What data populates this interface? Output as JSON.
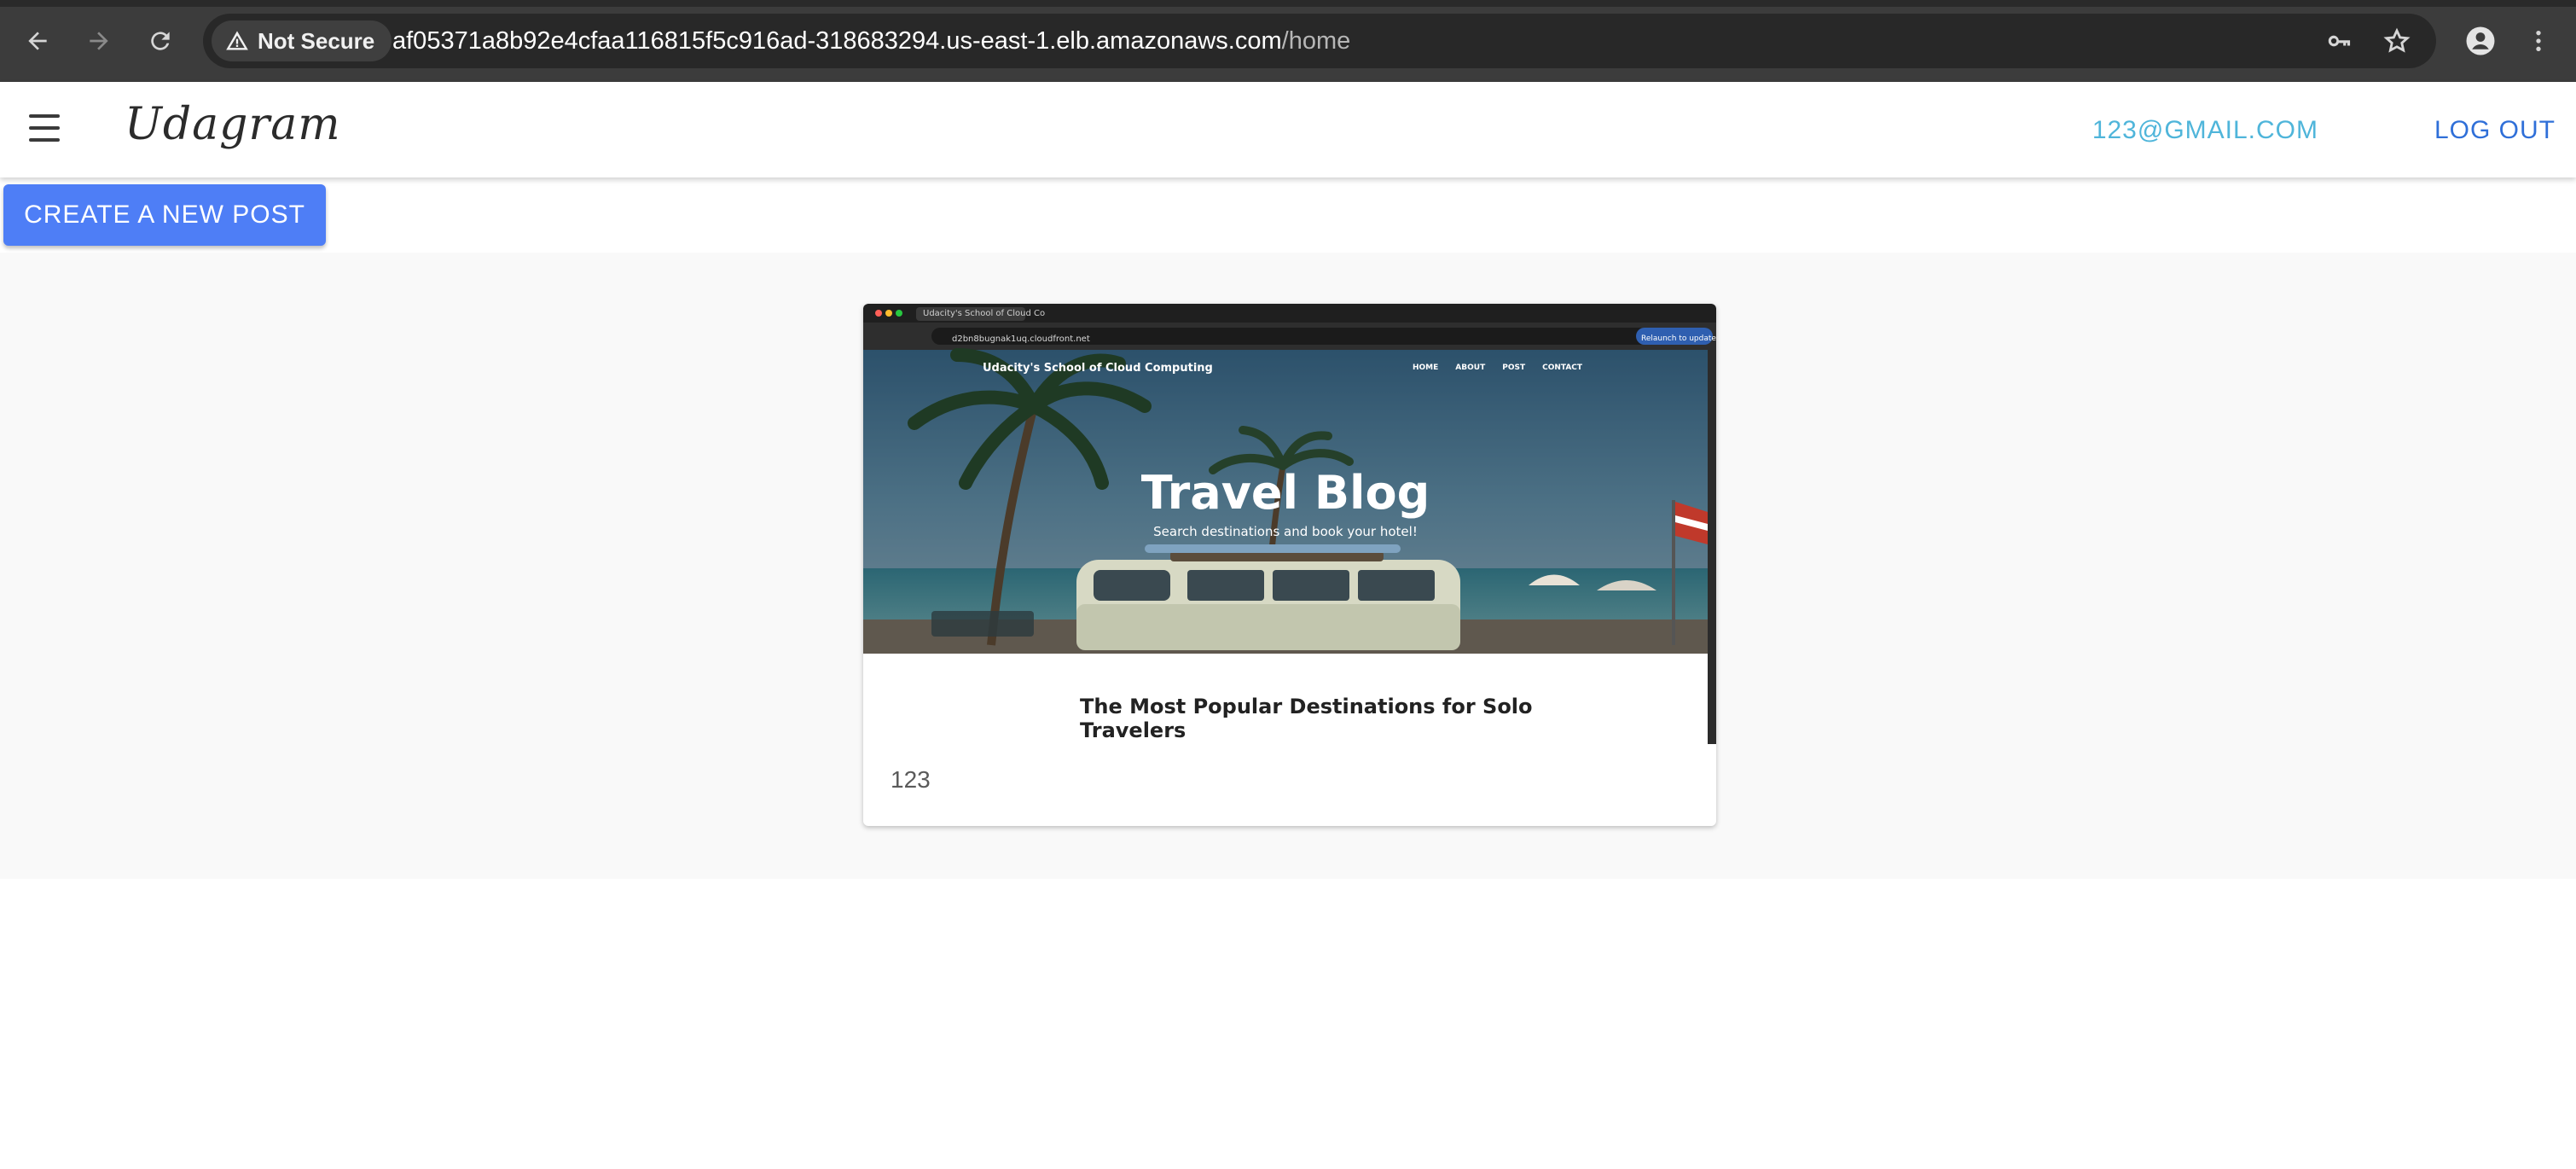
{
  "browser": {
    "security_label": "Not Secure",
    "url_host": "af05371a8b92e4cfaa116815f5c916ad-318683294.us-east-1.elb.amazonaws.com",
    "url_path": "/home",
    "icons": [
      "back-icon",
      "forward-icon",
      "reload-icon",
      "warning-icon",
      "key-icon",
      "star-icon",
      "profile-icon",
      "more-vert-icon"
    ]
  },
  "header": {
    "logo": "Udagram",
    "user_email": "123@GMAIL.COM",
    "logout_label": "LOG OUT",
    "menu_icon": "menu-icon"
  },
  "actions": {
    "create_post_label": "CREATE A NEW POST"
  },
  "feed": {
    "posts": [
      {
        "caption": "123",
        "image": {
          "tab_title": "Udacity's School of Cloud Co",
          "address": "d2bn8bugnak1uq.cloudfront.net",
          "relaunch_label": "Relaunch to update",
          "site_title": "Udacity's School of Cloud Computing",
          "nav": [
            "HOME",
            "ABOUT",
            "POST",
            "CONTACT"
          ],
          "hero_title": "Travel Blog",
          "hero_subtitle": "Search destinations and book your hotel!",
          "article_title_line1": "The Most Popular Destinations for Solo",
          "article_title_line2": "Travelers"
        }
      }
    ]
  },
  "colors": {
    "chrome_bg": "#3c3c3c",
    "omnibox_bg": "#282828",
    "primary_button": "#4e7ef6",
    "email_link": "#4fb5da",
    "logout_link": "#2f6fd8",
    "feed_bg": "#f9f9f9"
  }
}
